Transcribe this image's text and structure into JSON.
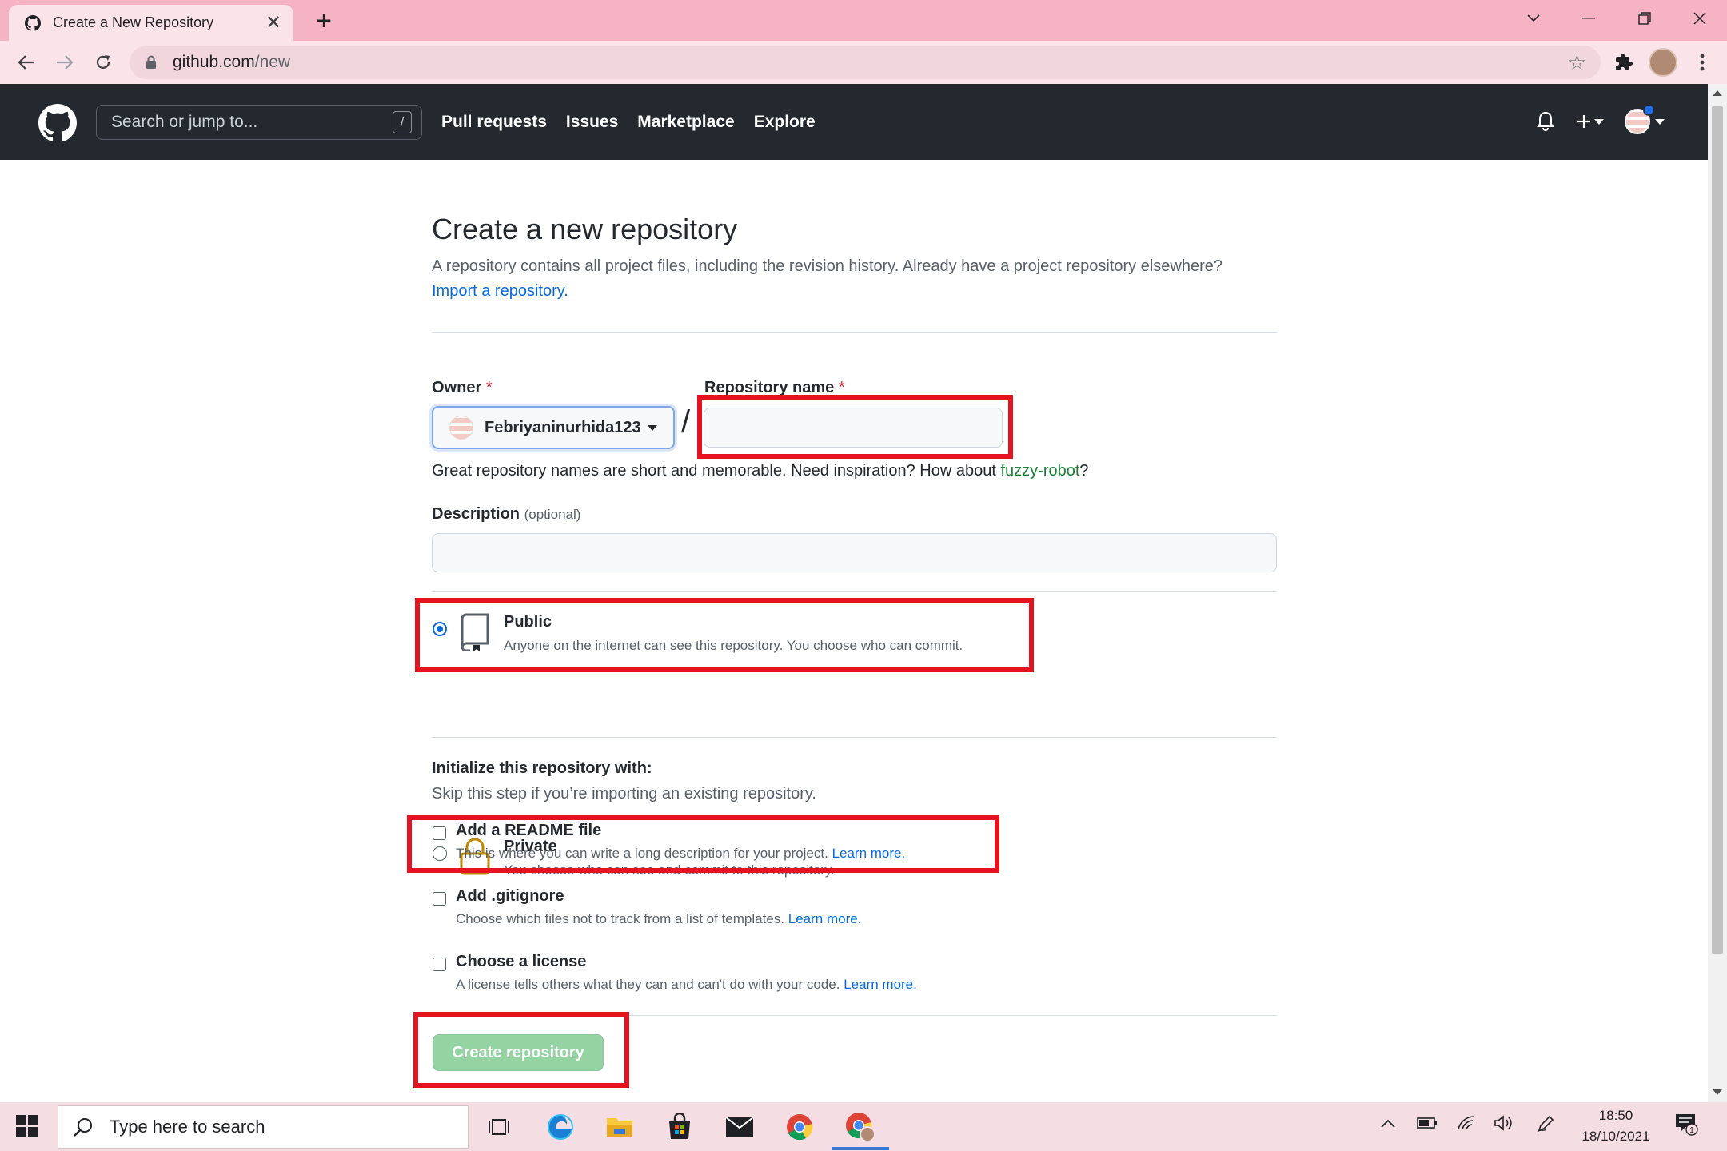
{
  "browser": {
    "tab_title": "Create a New Repository",
    "url_host": "github.com",
    "url_path": "/new"
  },
  "github": {
    "search_placeholder": "Search or jump to...",
    "search_shortcut": "/",
    "nav": [
      "Pull requests",
      "Issues",
      "Marketplace",
      "Explore"
    ]
  },
  "page": {
    "title": "Create a new repository",
    "subtitle": "A repository contains all project files, including the revision history. Already have a project repository elsewhere?",
    "import_link": "Import a repository.",
    "owner_label": "Owner",
    "required_mark": "*",
    "owner_value": "Febriyaninurhida123",
    "slash": "/",
    "repo_name_label": "Repository name",
    "repo_name_value": "",
    "hint_prefix": "Great repository names are short and memorable. Need inspiration? How about ",
    "hint_suggestion": "fuzzy-robot",
    "hint_suffix": "?",
    "description_label": "Description",
    "description_optional": "(optional)",
    "description_value": "",
    "visibility": {
      "selected": "public",
      "public_title": "Public",
      "public_desc": "Anyone on the internet can see this repository. You choose who can commit.",
      "private_title": "Private",
      "private_desc": "You choose who can see and commit to this repository."
    },
    "init_title": "Initialize this repository with:",
    "init_sub": "Skip this step if you’re importing an existing repository.",
    "readme_title": "Add a README file",
    "readme_desc": "This is where you can write a long description for your project.",
    "gitignore_title": "Add .gitignore",
    "gitignore_desc": "Choose which files not to track from a list of templates.",
    "license_title": "Choose a license",
    "license_desc": "A license tells others what they can and can't do with your code.",
    "learn_more": "Learn more.",
    "create_button": "Create repository"
  },
  "annotation_color": "#e5131f",
  "taskbar": {
    "search_placeholder": "Type here to search",
    "time": "18:50",
    "date": "18/10/2021",
    "notification_count": "1"
  }
}
